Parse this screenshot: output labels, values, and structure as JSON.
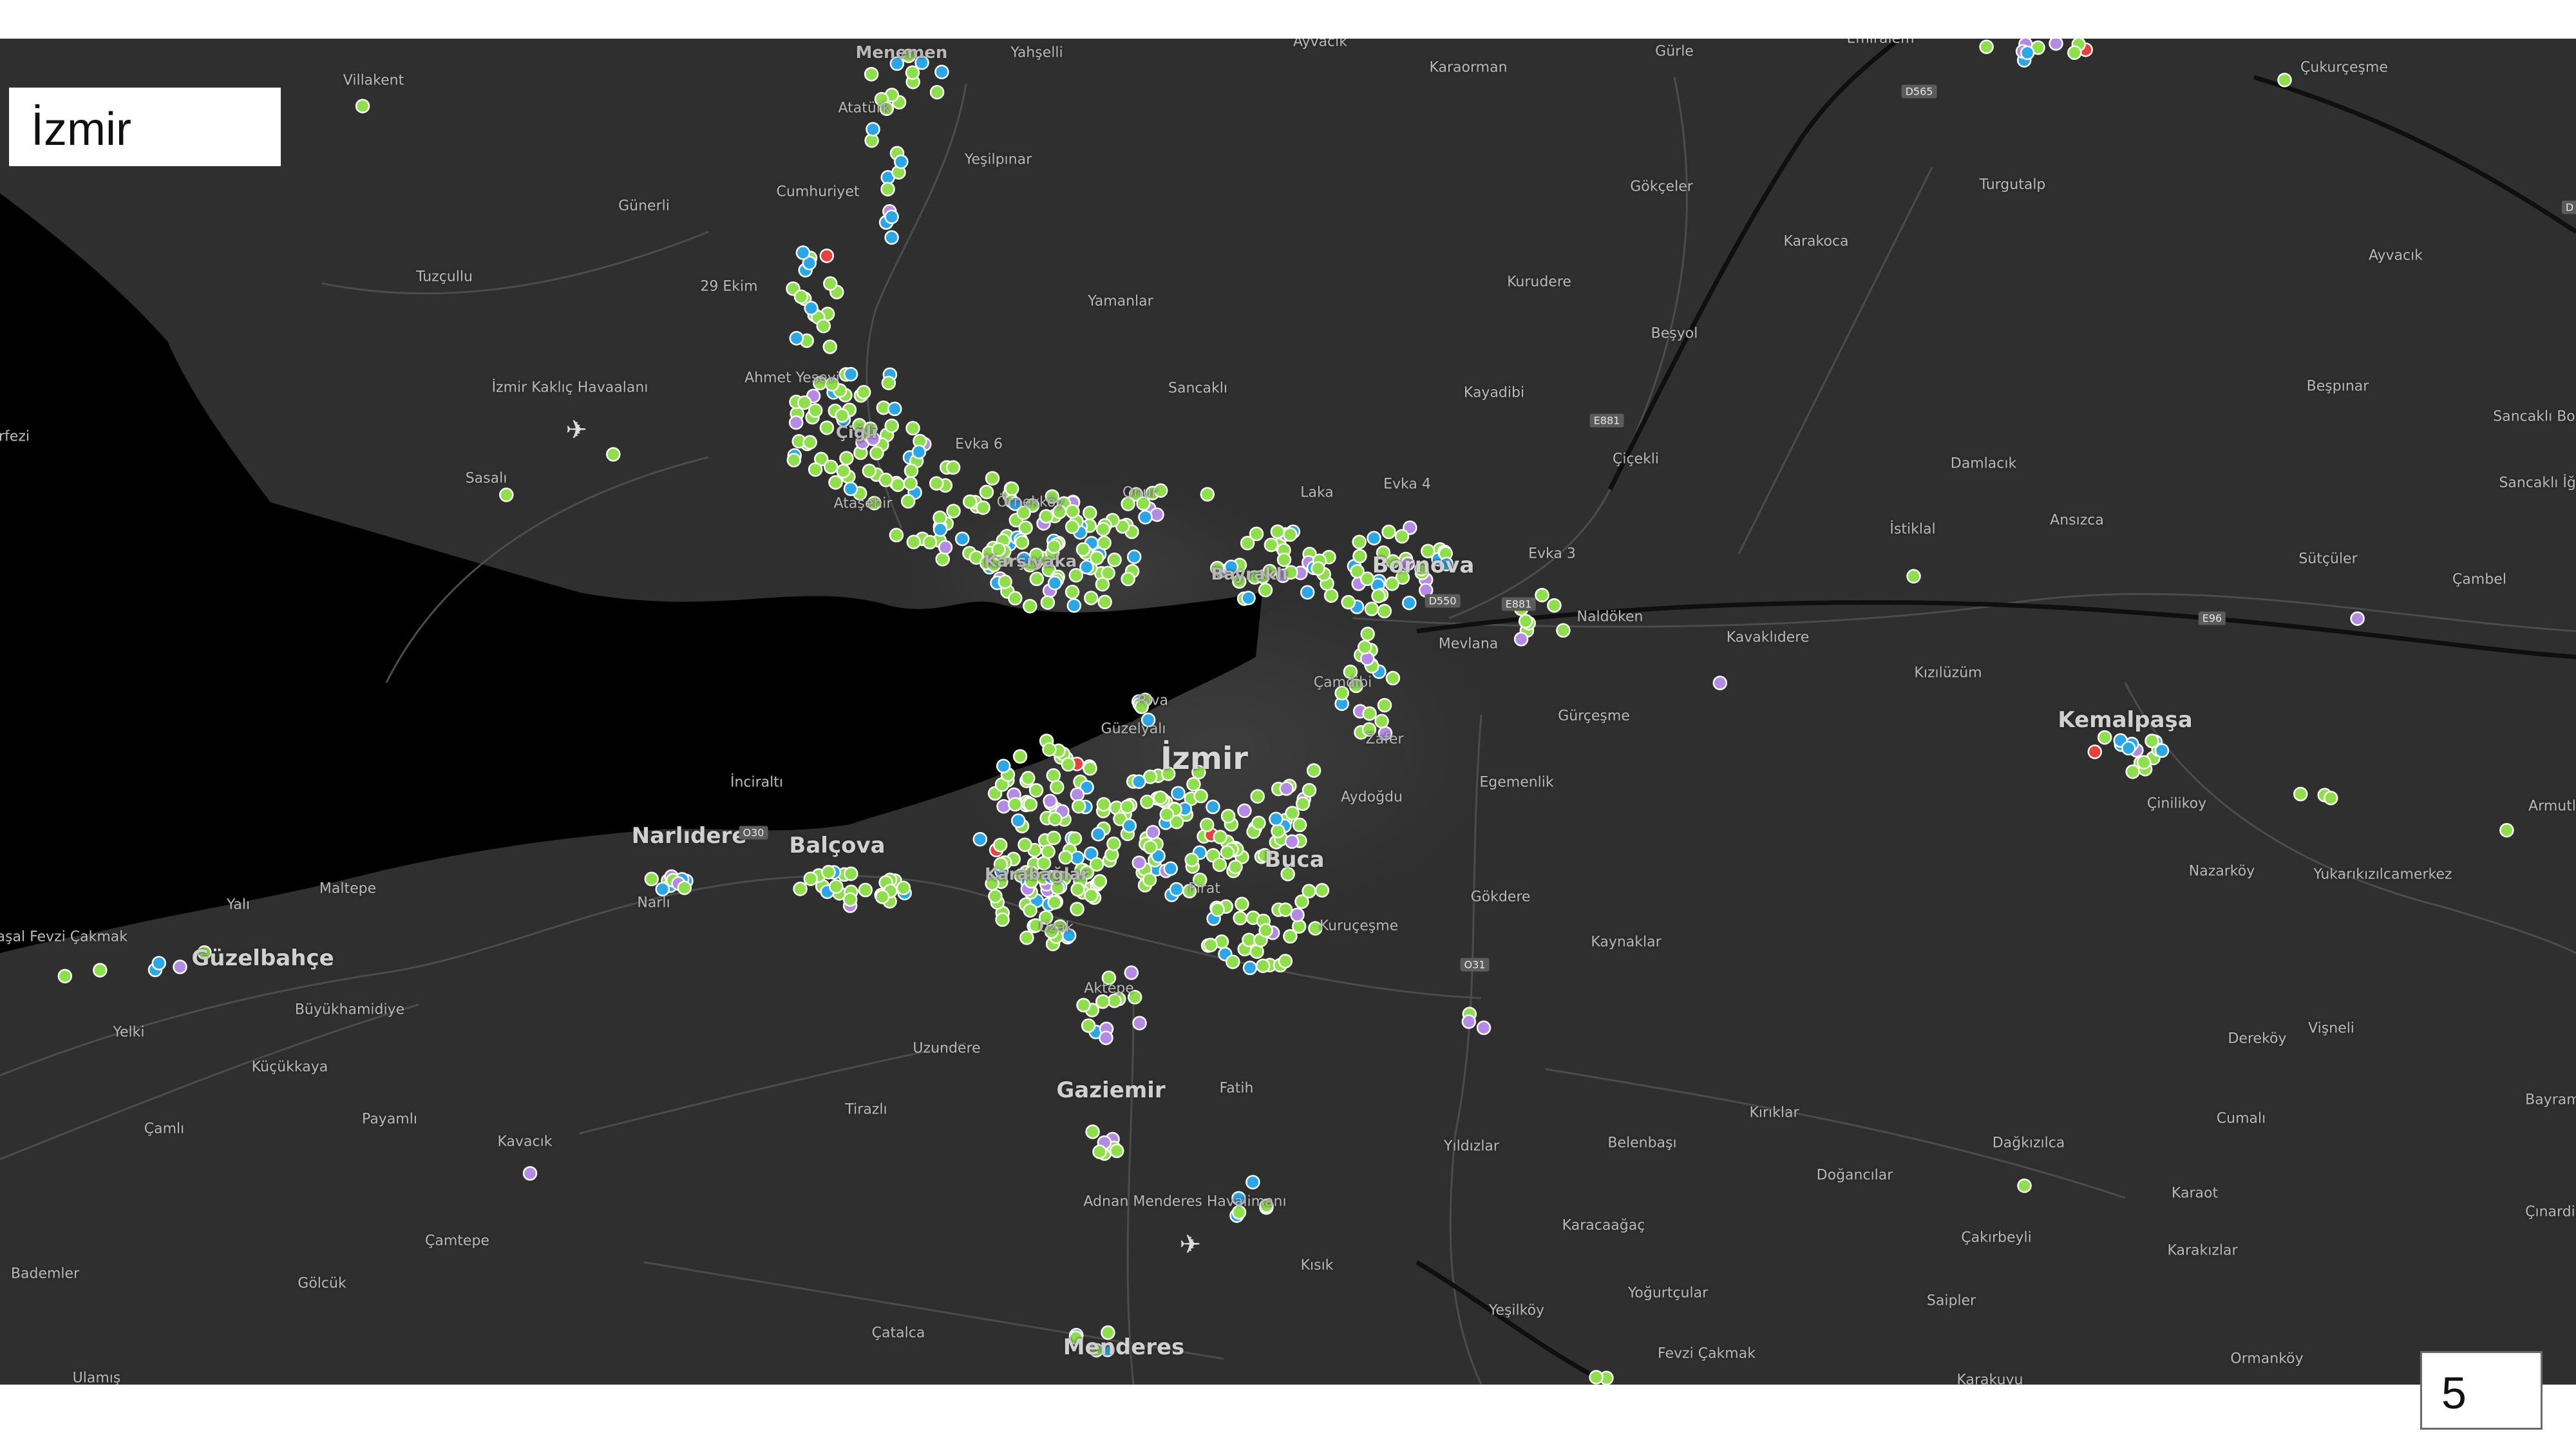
{
  "title": "İzmir",
  "page_number": "5",
  "colors": {
    "land": "#2f2f2f",
    "water": "#000000",
    "road": "#4a4a4a",
    "highway": "#111111",
    "green": "#8ee04a",
    "blue": "#2aa7e8",
    "purple": "#b48ae6",
    "red": "#e8403c"
  },
  "places": [
    {
      "name": "Menemen",
      "size": "mid"
    },
    {
      "name": "Yahşelli",
      "size": "small"
    },
    {
      "name": "Ayvacık",
      "size": "small"
    },
    {
      "name": "Karaorman",
      "size": "small"
    },
    {
      "name": "Gürle",
      "size": "small"
    },
    {
      "name": "Emiralem",
      "size": "small"
    },
    {
      "name": "Çukurçeşme",
      "size": "small"
    },
    {
      "name": "Villakent",
      "size": "small"
    },
    {
      "name": "Atatürk",
      "size": "small"
    },
    {
      "name": "Yeşilpınar",
      "size": "small"
    },
    {
      "name": "Günerli",
      "size": "small"
    },
    {
      "name": "Cumhuriyet",
      "size": "small"
    },
    {
      "name": "Gökçeler",
      "size": "small"
    },
    {
      "name": "Turgutalp",
      "size": "small"
    },
    {
      "name": "Karakoca",
      "size": "small"
    },
    {
      "name": "Ayvacık",
      "size": "small"
    },
    {
      "name": "Tuzçullu",
      "size": "small"
    },
    {
      "name": "29 Ekim",
      "size": "small"
    },
    {
      "name": "Yamanlar",
      "size": "small"
    },
    {
      "name": "Kurudere",
      "size": "small"
    },
    {
      "name": "Beşyol",
      "size": "small"
    },
    {
      "name": "İzmir Kaklıç Havaalanı",
      "size": "small"
    },
    {
      "name": "Ahmet Yesevi",
      "size": "small"
    },
    {
      "name": "Sancaklı",
      "size": "small"
    },
    {
      "name": "Kayadibi",
      "size": "small"
    },
    {
      "name": "Beşpınar",
      "size": "small"
    },
    {
      "name": "Sancaklı Bozköy",
      "size": "small"
    },
    {
      "name": "Çiğli",
      "size": "mid"
    },
    {
      "name": "Evka 6",
      "size": "small"
    },
    {
      "name": "Çiçekli",
      "size": "small"
    },
    {
      "name": "Damlacık",
      "size": "small"
    },
    {
      "name": "Sasalı",
      "size": "small"
    },
    {
      "name": "Örnekköy",
      "size": "small"
    },
    {
      "name": "Onur",
      "size": "small"
    },
    {
      "name": "Laka",
      "size": "small"
    },
    {
      "name": "Evka 4",
      "size": "small"
    },
    {
      "name": "Sancaklı İğdeli",
      "size": "small"
    },
    {
      "name": "Ataşehir",
      "size": "small"
    },
    {
      "name": "İstiklal",
      "size": "small"
    },
    {
      "name": "Ansızca",
      "size": "small"
    },
    {
      "name": "Karşıyaka",
      "size": "mid"
    },
    {
      "name": "Evka 3",
      "size": "small"
    },
    {
      "name": "Sütçüler",
      "size": "small"
    },
    {
      "name": "Bayraklı",
      "size": "mid"
    },
    {
      "name": "Bornova",
      "size": "big"
    },
    {
      "name": "Çambel",
      "size": "small"
    },
    {
      "name": "Naldöken",
      "size": "small"
    },
    {
      "name": "Mevlana",
      "size": "small"
    },
    {
      "name": "Kavaklıdere",
      "size": "small"
    },
    {
      "name": "Kızılüzüm",
      "size": "small"
    },
    {
      "name": "Riva",
      "size": "small"
    },
    {
      "name": "Çamdibi",
      "size": "small"
    },
    {
      "name": "Gürçeşme",
      "size": "small"
    },
    {
      "name": "Kemalpaşa",
      "size": "big"
    },
    {
      "name": "Güzelyalı",
      "size": "small"
    },
    {
      "name": "Zafer",
      "size": "small"
    },
    {
      "name": "İzmir",
      "size": "city"
    },
    {
      "name": "İnciraltı",
      "size": "small"
    },
    {
      "name": "Egemenlik",
      "size": "small"
    },
    {
      "name": "Çinilikoy",
      "size": "small"
    },
    {
      "name": "Aydoğdu",
      "size": "small"
    },
    {
      "name": "Armutlu",
      "size": "small"
    },
    {
      "name": "Narlıdere",
      "size": "big"
    },
    {
      "name": "Balçova",
      "size": "big"
    },
    {
      "name": "Karabağlar",
      "size": "mid"
    },
    {
      "name": "Buca",
      "size": "big"
    },
    {
      "name": "Nazarköy",
      "size": "small"
    },
    {
      "name": "Yukarıkızılcamerkez",
      "size": "small"
    },
    {
      "name": "Maltepe",
      "size": "small"
    },
    {
      "name": "Fırat",
      "size": "small"
    },
    {
      "name": "Gökdere",
      "size": "small"
    },
    {
      "name": "Karaşal Fevzi Çakmak",
      "size": "small"
    },
    {
      "name": "Yalı",
      "size": "small"
    },
    {
      "name": "Narlı",
      "size": "small"
    },
    {
      "name": "Kuruçeşme",
      "size": "small"
    },
    {
      "name": "Güzelbahçe",
      "size": "big"
    },
    {
      "name": "Kaynaklar",
      "size": "small"
    },
    {
      "name": "Uzak",
      "size": "small"
    },
    {
      "name": "Büyükhamidiye",
      "size": "small"
    },
    {
      "name": "Aktepe",
      "size": "small"
    },
    {
      "name": "Yelki",
      "size": "small"
    },
    {
      "name": "Uzundere",
      "size": "small"
    },
    {
      "name": "Vişneli",
      "size": "small"
    },
    {
      "name": "Dereköy",
      "size": "small"
    },
    {
      "name": "Küçükkaya",
      "size": "small"
    },
    {
      "name": "Gaziemir",
      "size": "big"
    },
    {
      "name": "Fatih",
      "size": "small"
    },
    {
      "name": "Bayramlı",
      "size": "small"
    },
    {
      "name": "Çamlı",
      "size": "small"
    },
    {
      "name": "Payamlı",
      "size": "small"
    },
    {
      "name": "Tirazlı",
      "size": "small"
    },
    {
      "name": "Kırıklar",
      "size": "small"
    },
    {
      "name": "Cumalı",
      "size": "small"
    },
    {
      "name": "Kavacık",
      "size": "small"
    },
    {
      "name": "Yıldızlar",
      "size": "small"
    },
    {
      "name": "Belenbaşı",
      "size": "small"
    },
    {
      "name": "Dağkızılca",
      "size": "small"
    },
    {
      "name": "Doğancılar",
      "size": "small"
    },
    {
      "name": "Karaot",
      "size": "small"
    },
    {
      "name": "Adnan Menderes Havalimanı",
      "size": "small"
    },
    {
      "name": "Çınardibi",
      "size": "small"
    },
    {
      "name": "Çamtepe",
      "size": "small"
    },
    {
      "name": "Karacaağaç",
      "size": "small"
    },
    {
      "name": "Çakırbeyli",
      "size": "small"
    },
    {
      "name": "Kısık",
      "size": "small"
    },
    {
      "name": "Karakızlar",
      "size": "small"
    },
    {
      "name": "Bademler",
      "size": "small"
    },
    {
      "name": "Gölcük",
      "size": "small"
    },
    {
      "name": "Yoğurtçular",
      "size": "small"
    },
    {
      "name": "Saipler",
      "size": "small"
    },
    {
      "name": "Yeşilköy",
      "size": "small"
    },
    {
      "name": "Çatalca",
      "size": "small"
    },
    {
      "name": "Menderes",
      "size": "big"
    },
    {
      "name": "Fevzi Çakmak",
      "size": "small"
    },
    {
      "name": "Ormanköy",
      "size": "small"
    },
    {
      "name": "Ulamış",
      "size": "small"
    },
    {
      "name": "Karakuyu",
      "size": "small"
    },
    {
      "name": "rfezi",
      "size": "small"
    }
  ],
  "road_shields": [
    "D565",
    "E881",
    "D550",
    "E881",
    "E96",
    "O30",
    "O31",
    "D"
  ]
}
